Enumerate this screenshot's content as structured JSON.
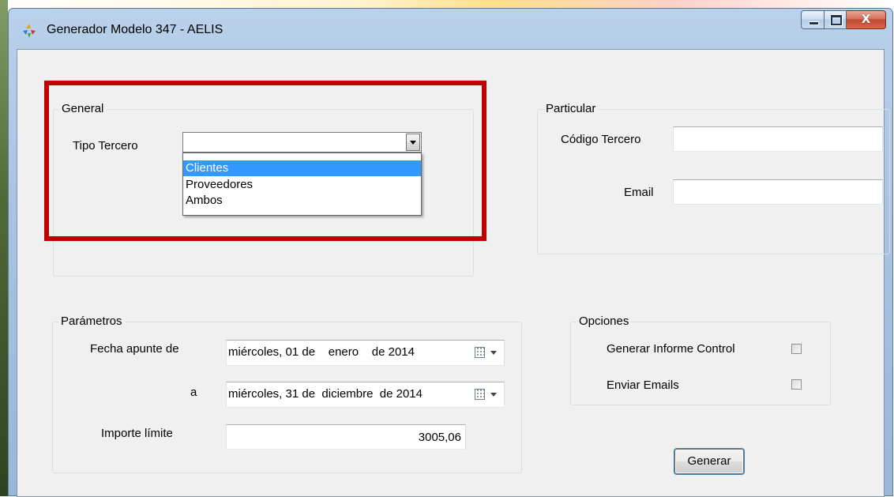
{
  "window": {
    "title": "Generador Modelo 347 - AELIS",
    "close_glyph": "X"
  },
  "general": {
    "legend": "General",
    "tipo_label": "Tipo Tercero",
    "tipo_value": "",
    "dropdown_items": [
      "Clientes",
      "Proveedores",
      "Ambos"
    ],
    "selected_item": "Clientes"
  },
  "particular": {
    "legend": "Particular",
    "codigo_label": "Código Tercero",
    "codigo_value": "",
    "email_label": "Email",
    "email_value": ""
  },
  "parametros": {
    "legend": "Parámetros",
    "fecha_label": "Fecha apunte de",
    "fecha_desde": "miércoles, 01 de    enero    de 2014",
    "a_label": "a",
    "fecha_hasta": "miércoles, 31 de  diciembre  de 2014",
    "importe_label": "Importe límite",
    "importe_value": "3005,06"
  },
  "opciones": {
    "legend": "Opciones",
    "informe_label": "Generar Informe Control",
    "informe_checked": false,
    "emails_label": "Enviar Emails",
    "emails_checked": false
  },
  "actions": {
    "generar_label": "Generar"
  },
  "colors": {
    "highlight": "#c00000",
    "selection": "#3399ff"
  }
}
